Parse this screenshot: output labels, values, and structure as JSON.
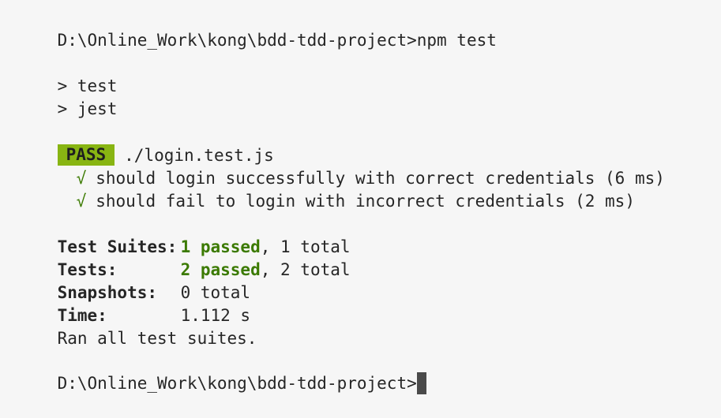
{
  "terminal": {
    "prompt_1": "D:\\Online_Work\\kong\\bdd-tdd-project>npm test",
    "script_line_1": "> test",
    "script_line_2": "> jest",
    "suite": {
      "badge": "PASS",
      "file": "./login.test.js"
    },
    "tests": [
      {
        "icon": "check-icon",
        "mark": "√",
        "text": "should login successfully with correct credentials (6 ms)"
      },
      {
        "icon": "check-icon",
        "mark": "√",
        "text": "should fail to login with incorrect credentials (2 ms)"
      }
    ],
    "summary": {
      "suites_label": "Test Suites:",
      "suites_passed": "1 passed",
      "suites_rest": ", 1 total",
      "tests_label": "Tests:",
      "tests_passed": "2 passed",
      "tests_rest": ", 2 total",
      "snapshots_label": "Snapshots:",
      "snapshots_value": "0 total",
      "time_label": "Time:",
      "time_value": "1.112 s",
      "ran_all": "Ran all test suites."
    },
    "prompt_2": "D:\\Online_Work\\kong\\bdd-tdd-project>"
  },
  "colors": {
    "background": "#f6f6f6",
    "text": "#262626",
    "pass_badge": "#88b512",
    "pass_green": "#3b7a00",
    "cursor": "#4a4a4a"
  }
}
